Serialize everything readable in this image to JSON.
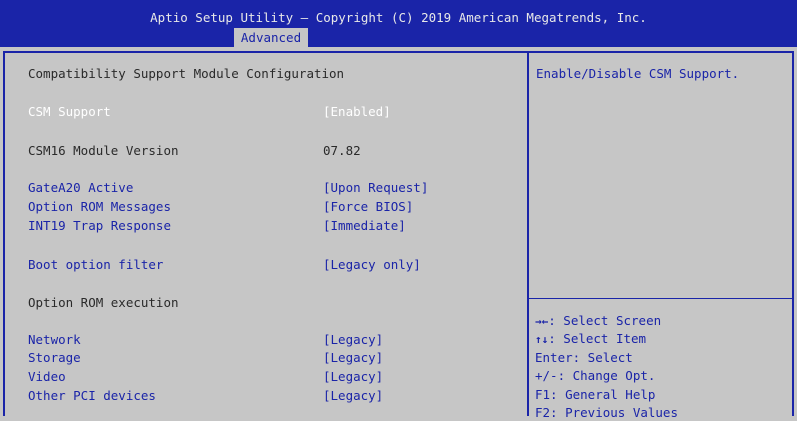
{
  "header": {
    "title": "Aptio Setup Utility – Copyright (C) 2019 American Megatrends, Inc.",
    "active_tab": "Advanced"
  },
  "section_title": "Compatibility Support Module Configuration",
  "settings": [
    {
      "label": "CSM Support",
      "value": "[Enabled]"
    },
    {
      "label": "CSM16 Module Version",
      "value": "07.82"
    },
    {
      "label": "GateA20 Active",
      "value": "[Upon Request]"
    },
    {
      "label": "Option ROM Messages",
      "value": "[Force BIOS]"
    },
    {
      "label": "INT19 Trap Response",
      "value": "[Immediate]"
    },
    {
      "label": "Boot option filter",
      "value": "[Legacy only]"
    },
    {
      "label": "Option ROM execution"
    },
    {
      "label": "Network",
      "value": "[Legacy]"
    },
    {
      "label": "Storage",
      "value": "[Legacy]"
    },
    {
      "label": "Video",
      "value": "[Legacy]"
    },
    {
      "label": "Other PCI devices",
      "value": "[Legacy]"
    }
  ],
  "help": {
    "description": "Enable/Disable CSM Support."
  },
  "keys": [
    {
      "glyph": "→←",
      "text": ": Select Screen",
      "icon": "left-right-arrows-icon"
    },
    {
      "glyph": "↑↓",
      "text": ": Select Item",
      "icon": "up-down-arrows-icon"
    },
    {
      "text": "Enter: Select"
    },
    {
      "text": "+/-: Change Opt."
    },
    {
      "text": "F1: General Help"
    },
    {
      "text": "F2: Previous Values"
    }
  ],
  "colors": {
    "background": "#c6c6c6",
    "accent_blue": "#1a24a8",
    "selected_text": "#ffffff",
    "static_text": "#2a2a2a"
  }
}
